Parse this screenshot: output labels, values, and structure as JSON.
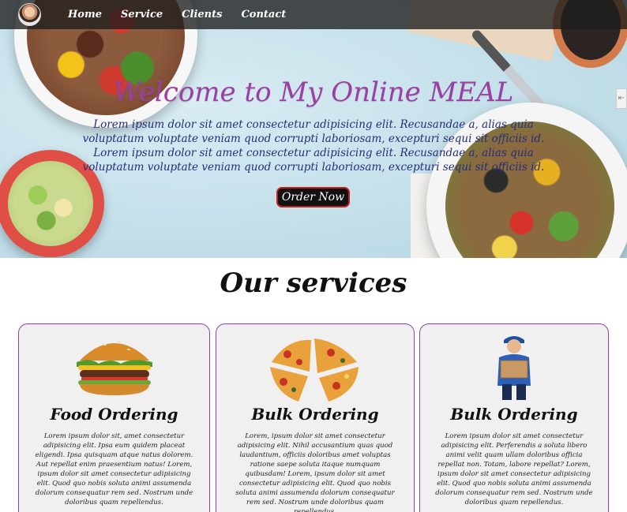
{
  "nav": {
    "links": [
      "Home",
      "Service",
      "Clients",
      "Contact"
    ]
  },
  "hero": {
    "title": "Welcome to My Online MEAL",
    "paragraph_1": "Lorem ipsum dolor sit amet consectetur adipisicing elit. Recusandae a, alias quia voluptatum voluptate veniam quod corrupti laboriosam, excepturi sequi sit officiis id.",
    "paragraph_2": "Lorem ipsum dolor sit amet consectetur adipisicing elit. Recusandae a, alias quia voluptatum voluptate veniam quod corrupti laboriosam, excepturi sequi sit officiis id.",
    "button_label": "Order Now",
    "side_handle": "⇤"
  },
  "services": {
    "title": "Our services",
    "cards": [
      {
        "icon": "burger",
        "title": "Food Ordering",
        "text": "Lorem ipsum dolor sit, amet consectetur adipisicing elit. Ipsa eum quidem placeat eligendi. Ipsa quisquam atque natus dolorem. Aut repellat enim praesentium natus! Lorem, ipsum dolor sit amet consectetur adipisicing elit. Quod quo nobis soluta animi assumenda dolorum consequatur rem sed. Nostrum unde doloribus quam repellendus."
      },
      {
        "icon": "pizza",
        "title": "Bulk Ordering",
        "text": "Lorem, ipsum dolor sit amet consectetur adipisicing elit. Nihil accusantium quas quod laudantium, officiis doloribus amet voluptas ratione saepe soluta itaque numquam quibusdam! Lorem, ipsum dolor sit amet consectetur adipisicing elit. Quod quo nobis soluta animi assumenda dolorum consequatur rem sed. Nostrum unde doloribus quam repellendus."
      },
      {
        "icon": "delivery-man",
        "title": "Bulk Ordering",
        "text": "Lorem ipsum dolor sit amet consectetur adipisicing elit. Perferendis a soluta libero animi velit quam ullam doloribus officia repellat non. Totam, labore repellat? Lorem, ipsum dolor sit amet consectetur adipisicing elit. Quod quo nobis soluta animi assumenda dolorum consequatur rem sed. Nostrum unde doloribus quam repellendus."
      }
    ]
  },
  "colors": {
    "hero_title": "#9b3fa3",
    "hero_text": "#242e78",
    "card_border": "#8e3fb0",
    "card_bg": "#f1f0f1",
    "button_border": "#c0221f"
  }
}
